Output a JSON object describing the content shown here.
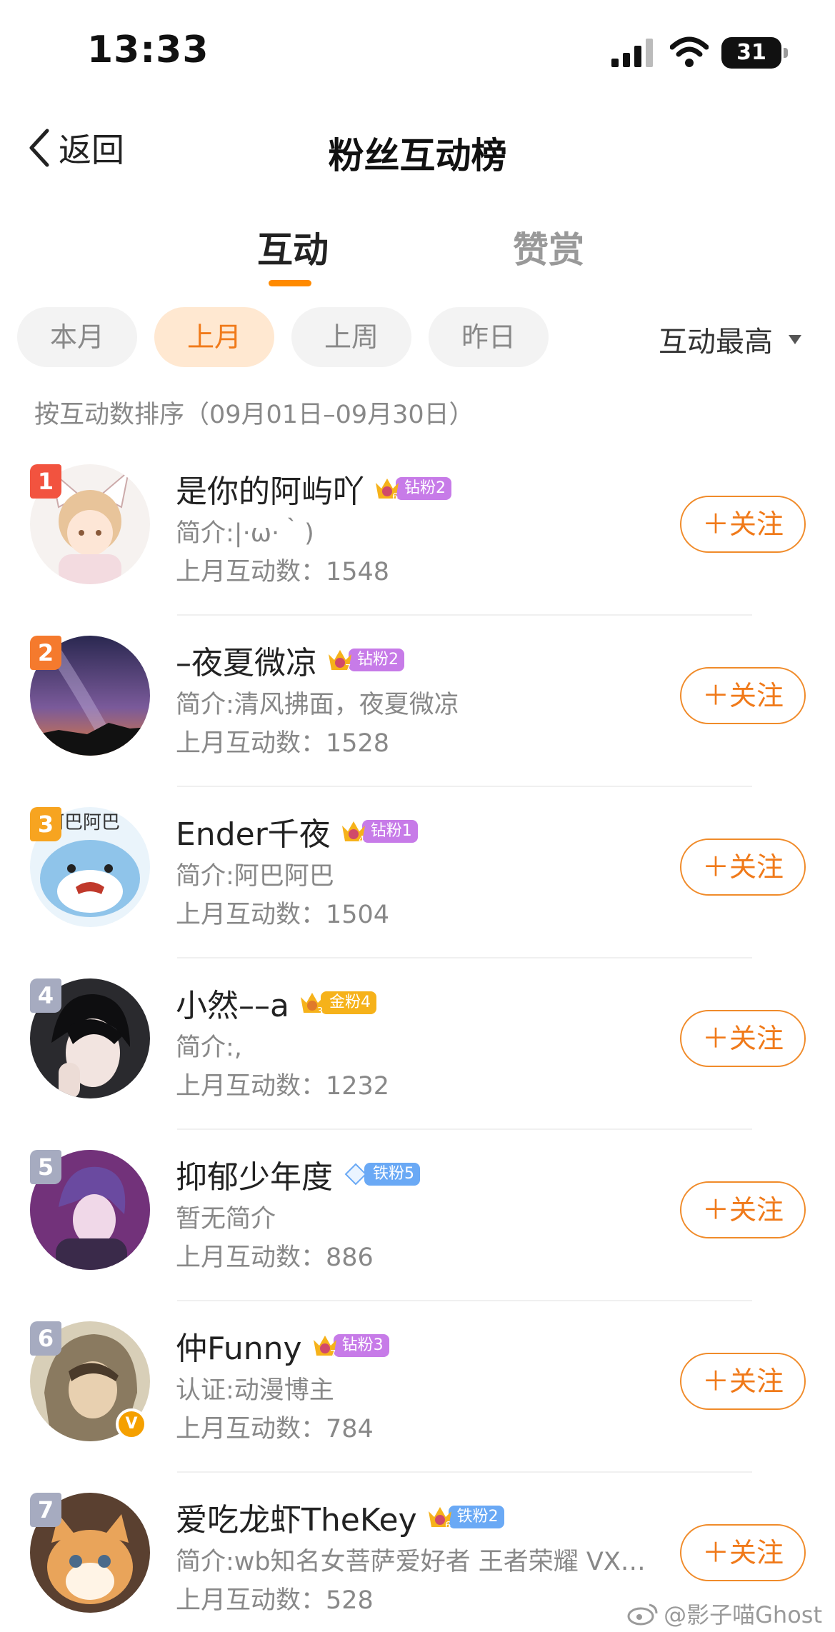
{
  "status_bar": {
    "time": "13:33",
    "battery": "31"
  },
  "nav": {
    "back_label": "返回",
    "title": "粉丝互动榜"
  },
  "tabs": [
    {
      "label": "互动"
    },
    {
      "label": "赞赏"
    }
  ],
  "filters": {
    "chips": [
      "本月",
      "上月",
      "上周",
      "昨日"
    ],
    "active_chip": "上月",
    "sort_label": "互动最高"
  },
  "sort_description": "按互动数排序（09月01日–09月30日）",
  "colors": {
    "accent": "#f07a1a",
    "diamond_badge": "#c77be8",
    "gold_badge": "#f6b21a",
    "iron_badge": "#6aa9f5",
    "rank_1": "#f2533f",
    "rank_2": "#f57a2d",
    "rank_3": "#f7a420",
    "rank_other": "#a6abc0"
  },
  "follow_label": "＋关注",
  "fans": [
    {
      "rank": "1",
      "name": "是你的阿屿吖",
      "badge_level": "6",
      "badge_text": "钻粉2",
      "badge_type": "diamond",
      "bio": "简介:|·ω·｀)",
      "count": "上月互动数：1548",
      "avatar": "anime-girl-fox-ears"
    },
    {
      "rank": "2",
      "name": "–夜夏微凉",
      "badge_level": "7",
      "badge_text": "钻粉2",
      "badge_type": "diamond",
      "bio": "简介:清风拂面，夜夏微凉",
      "count": "上月互动数：1528",
      "avatar": "starry-night-sky"
    },
    {
      "rank": "3",
      "name": "Ender千夜",
      "badge_level": "4",
      "badge_text": "钻粉1",
      "badge_type": "diamond",
      "bio": "简介:阿巴阿巴",
      "count": "上月互动数：1504",
      "avatar": "cartoon-shark-abaaba"
    },
    {
      "rank": "4",
      "name": "小然––a",
      "badge_level": "3",
      "badge_text": "金粉4",
      "badge_type": "gold",
      "bio": "简介:,",
      "count": "上月互动数：1232",
      "avatar": "person-portrait-dark-hair"
    },
    {
      "rank": "5",
      "name": "抑郁少年度",
      "badge_level": "",
      "badge_text": "铁粉5",
      "badge_type": "iron",
      "bio": "暂无简介",
      "count": "上月互动数：886",
      "avatar": "anime-boy-purple"
    },
    {
      "rank": "6",
      "name": "仲Funny",
      "badge_level": "7",
      "badge_text": "钻粉3",
      "badge_type": "diamond",
      "bio": "认证:动漫博主",
      "count": "上月互动数：784",
      "avatar": "anime-boy-hood",
      "verified": "V"
    },
    {
      "rank": "7",
      "name": "爱吃龙虾TheKey",
      "badge_level": "6",
      "badge_text": "铁粉2",
      "badge_type": "iron",
      "bio": "简介:wb知名女菩萨爱好者 王者荣耀 VX…",
      "count": "上月互动数：528",
      "avatar": "kitten"
    }
  ],
  "watermark": "@影子喵Ghost"
}
